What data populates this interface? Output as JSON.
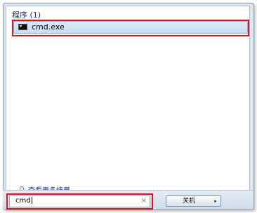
{
  "results": {
    "section_title": "程序 (1)",
    "items": [
      {
        "label": "cmd.exe",
        "icon": "cmd-icon"
      }
    ]
  },
  "see_more": {
    "label": "查看更多结果",
    "icon": "search-icon"
  },
  "search": {
    "value": "cmd",
    "clear_icon": "close-icon"
  },
  "power": {
    "label": "关机",
    "arrow": "▸"
  },
  "colors": {
    "highlight_border": "#e0141c",
    "selected_bg": "#c8ddf3",
    "link_text": "#1e3287",
    "frame_bg": "#dbe7f2"
  }
}
